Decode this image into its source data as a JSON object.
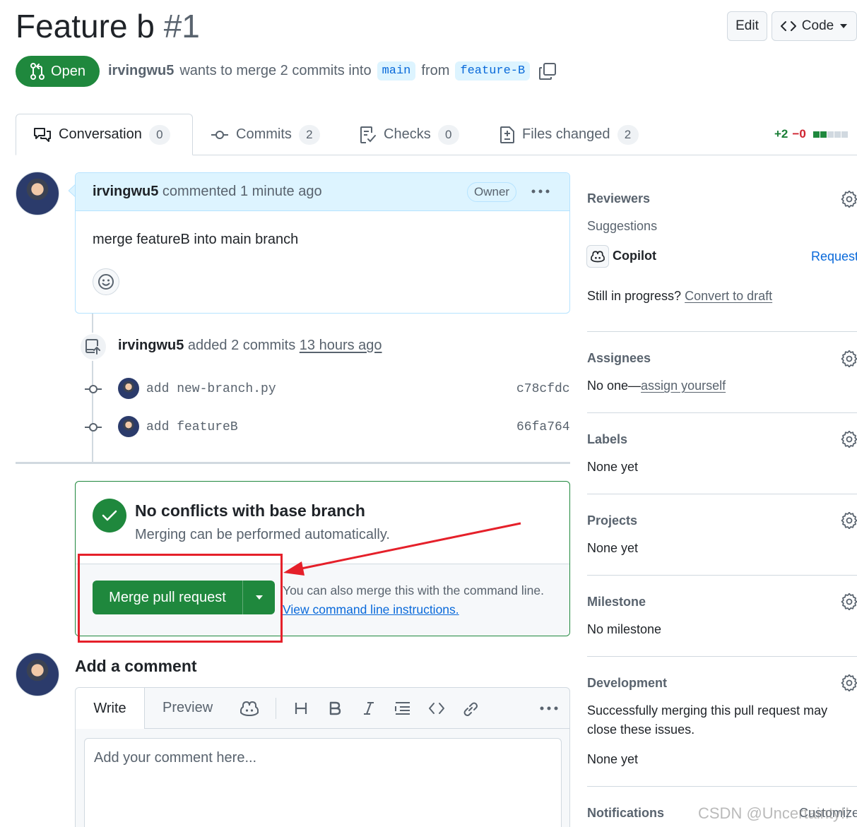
{
  "header": {
    "title": "Feature b",
    "number": "#1",
    "edit_label": "Edit",
    "code_label": "Code"
  },
  "state": {
    "label": "Open",
    "author": "irvingwu5",
    "text": "wants to merge 2 commits into",
    "base": "main",
    "from_word": "from",
    "head": "feature-B"
  },
  "tabs": [
    {
      "label": "Conversation",
      "count": "0"
    },
    {
      "label": "Commits",
      "count": "2"
    },
    {
      "label": "Checks",
      "count": "0"
    },
    {
      "label": "Files changed",
      "count": "2"
    }
  ],
  "diffstat": {
    "additions": "+2",
    "deletions": "−0"
  },
  "comment": {
    "author": "irvingwu5",
    "action": "commented 1 minute ago",
    "badge": "Owner",
    "body": "merge featureB into main branch"
  },
  "commits_event": {
    "author": "irvingwu5",
    "action": "added 2 commits",
    "time": "13 hours ago",
    "items": [
      {
        "message": "add new-branch.py",
        "sha": "c78cfdc"
      },
      {
        "message": "add featureB",
        "sha": "66fa764"
      }
    ]
  },
  "merge": {
    "title": "No conflicts with base branch",
    "subtitle": "Merging can be performed automatically.",
    "button": "Merge pull request",
    "cli_text": "You can also merge this with the command line.",
    "cli_link": "View command line instructions."
  },
  "add_comment": {
    "heading": "Add a comment",
    "write_tab": "Write",
    "preview_tab": "Preview",
    "placeholder": "Add your comment here..."
  },
  "sidebar": {
    "reviewers": {
      "heading": "Reviewers",
      "suggestions": "Suggestions",
      "copilot": "Copilot",
      "request": "Request",
      "progress": "Still in progress?",
      "draft": "Convert to draft"
    },
    "assignees": {
      "heading": "Assignees",
      "none": "No one—",
      "link": "assign yourself"
    },
    "labels": {
      "heading": "Labels",
      "value": "None yet"
    },
    "projects": {
      "heading": "Projects",
      "value": "None yet"
    },
    "milestone": {
      "heading": "Milestone",
      "value": "No milestone"
    },
    "development": {
      "heading": "Development",
      "text": "Successfully merging this pull request may close these issues.",
      "value": "None yet"
    },
    "notifications": {
      "heading": "Notifications",
      "customize": "Customize"
    }
  },
  "watermark": "CSDN @Uncertainty!!",
  "colors": {
    "green": "#1f883d",
    "accent": "#0969da",
    "annotation_red": "#e5202a"
  }
}
